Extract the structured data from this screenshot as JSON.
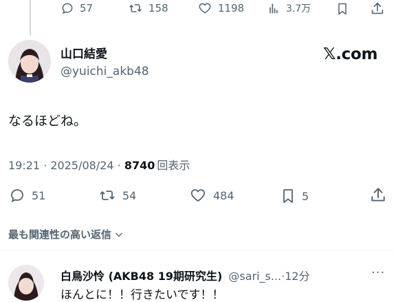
{
  "top_actions": {
    "replies": "57",
    "reposts": "158",
    "likes": "1198",
    "views": "3.7万"
  },
  "tweet": {
    "display_name": "山口結愛",
    "handle": "@yuichi_akb48",
    "text": "なるほどね。",
    "time": "19:21 · 2025/08/24 · ",
    "views_count": "8740",
    "views_label": "回表示",
    "brand": "𝕏.com",
    "replies": "51",
    "reposts": "54",
    "likes": "484",
    "bookmarks": "5"
  },
  "sort": {
    "label": "最も関連性の高い返信"
  },
  "reply": {
    "display_name": "白鳥沙怜 (AKB48 19期研究生)",
    "handle_time": "@sari_s...·12分",
    "text": "ほんとに！！行きたいです！！"
  },
  "colors": {
    "text": "#0f1419",
    "secondary": "#536471",
    "divider": "#eff3f4"
  }
}
